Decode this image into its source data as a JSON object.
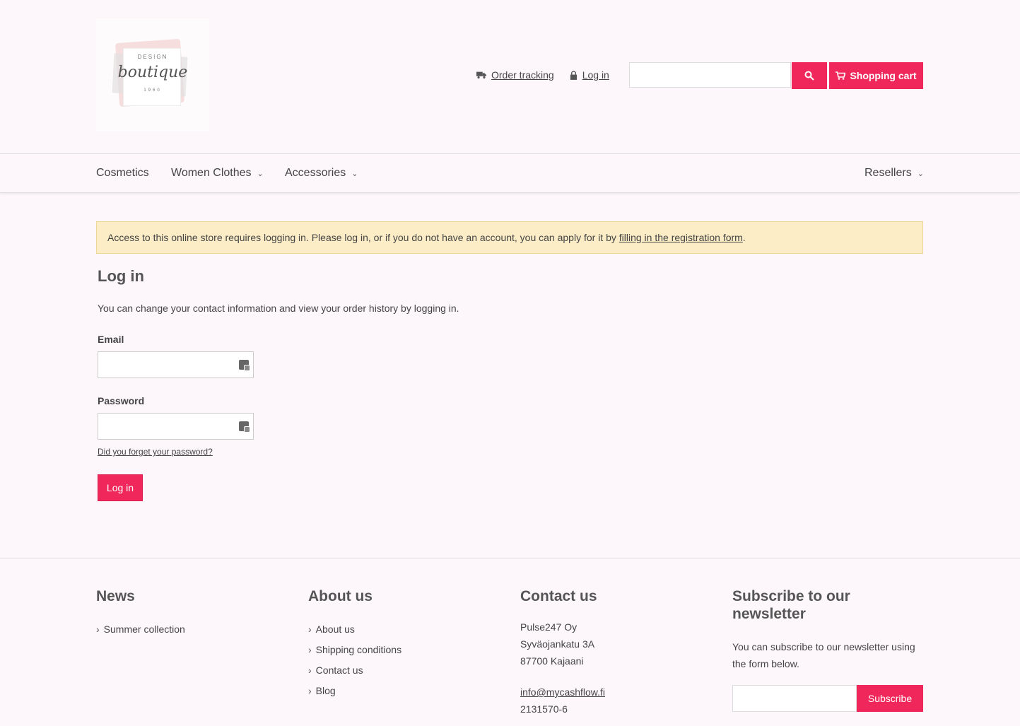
{
  "logo": {
    "line1": "DESIGN",
    "line2": "boutique",
    "line3": "1960"
  },
  "header": {
    "order_tracking": "Order tracking",
    "login": "Log in",
    "search": {
      "value": "",
      "placeholder": ""
    },
    "cart": "Shopping cart"
  },
  "nav": {
    "items": [
      {
        "label": "Cosmetics",
        "has_dropdown": false
      },
      {
        "label": "Women Clothes",
        "has_dropdown": true
      },
      {
        "label": "Accessories",
        "has_dropdown": true
      }
    ],
    "right": {
      "label": "Resellers",
      "has_dropdown": true
    }
  },
  "notice": {
    "text": "Access to this online store requires logging in. Please log in, or if you do not have an account, you can apply for it by ",
    "link": "filling in the registration form",
    "end": "."
  },
  "login": {
    "title": "Log in",
    "intro": "You can change your contact information and view your order history by logging in.",
    "email_label": "Email",
    "email_value": "",
    "password_label": "Password",
    "password_value": "",
    "forgot": "Did you forget your password?",
    "button": "Log in"
  },
  "footer": {
    "news": {
      "title": "News",
      "items": [
        "Summer collection"
      ]
    },
    "about": {
      "title": "About us",
      "items": [
        "About us",
        "Shipping conditions",
        "Contact us",
        "Blog"
      ]
    },
    "contact": {
      "title": "Contact us",
      "company": "Pulse247 Oy",
      "street": "Syväojankatu 3A",
      "city": "87700 Kajaani",
      "email": "info@mycashflow.fi",
      "business_id": "2131570-6"
    },
    "newsletter": {
      "title": "Subscribe to our newsletter",
      "text": "You can subscribe to our newsletter using the form below.",
      "input_value": "",
      "button": "Subscribe"
    }
  },
  "colors": {
    "accent": "#f0275a",
    "notice_bg": "#fcedc7",
    "page_bg": "#fdf7fb"
  }
}
